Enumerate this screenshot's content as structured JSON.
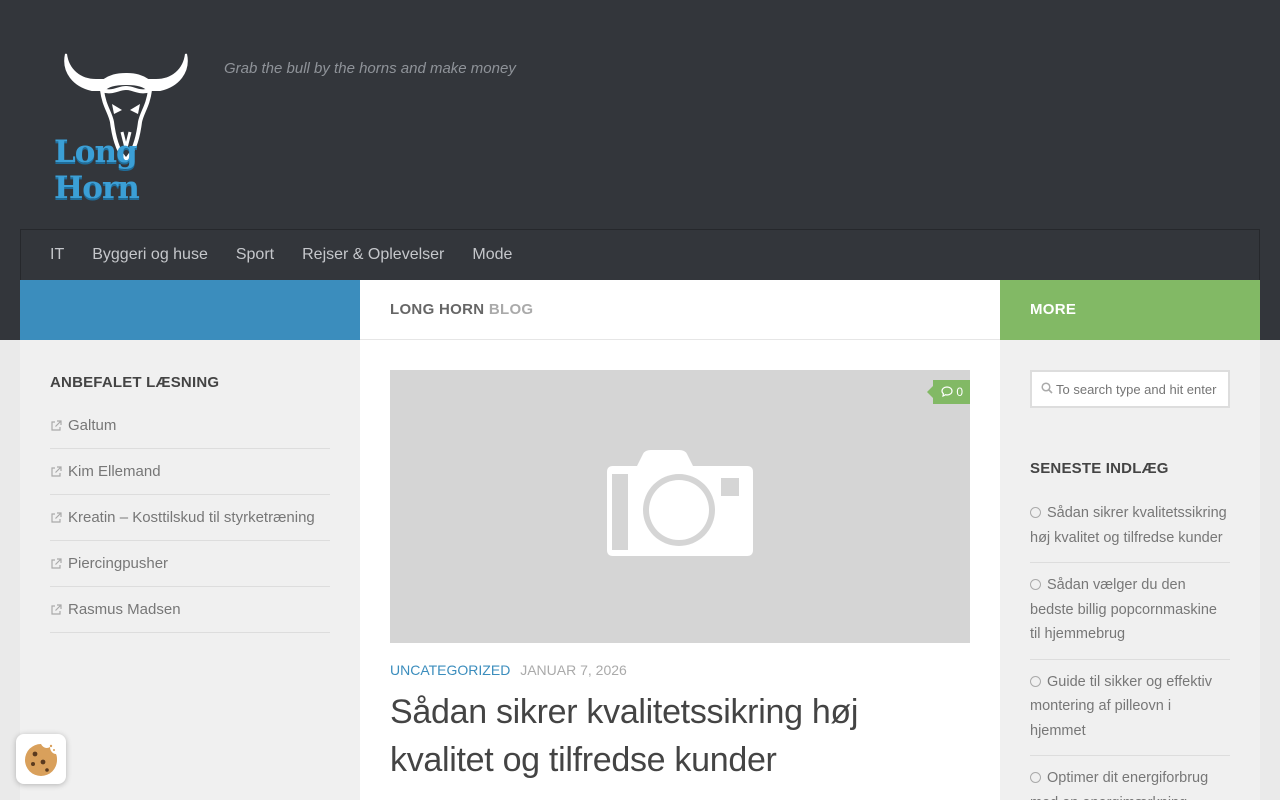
{
  "site": {
    "logo_text": "Long Horn",
    "tagline": "Grab the bull by the horns and make money"
  },
  "nav": {
    "items": [
      {
        "label": "IT"
      },
      {
        "label": "Byggeri og huse"
      },
      {
        "label": "Sport"
      },
      {
        "label": "Rejser & Oplevelser"
      },
      {
        "label": "Mode"
      }
    ]
  },
  "page_title": {
    "strong": "LONG HORN",
    "light": "BLOG"
  },
  "left_sidebar": {
    "title": "ANBEFALET LÆSNING",
    "links": [
      {
        "label": "Galtum"
      },
      {
        "label": "Kim Ellemand"
      },
      {
        "label": "Kreatin – Kosttilskud til styrketræning"
      },
      {
        "label": "Piercingpusher"
      },
      {
        "label": "Rasmus Madsen"
      }
    ]
  },
  "post": {
    "comment_count": "0",
    "category": "UNCATEGORIZED",
    "date": "JANUAR 7, 2026",
    "title": "Sådan sikrer kvalitetssikring høj kvalitet og tilfredse kunder"
  },
  "right_sidebar": {
    "header": "MORE",
    "search_placeholder": "To search type and hit enter",
    "recent_title": "SENESTE INDLÆG",
    "recent": [
      {
        "label": "Sådan sikrer kvalitetssikring høj kvalitet og tilfredse kunder"
      },
      {
        "label": "Sådan vælger du den bedste billig popcornmaskine til hjemmebrug"
      },
      {
        "label": "Guide til sikker og effektiv montering af pilleovn i hjemmet"
      },
      {
        "label": "Optimer dit energiforbrug med en energimærkning"
      }
    ]
  },
  "colors": {
    "header_bg": "#33363b",
    "blue": "#3b8dbd",
    "green": "#82b965"
  },
  "icons": {
    "external_link": "external-link-icon",
    "clock": "clock-icon",
    "search": "search-icon",
    "comment": "comment-icon",
    "camera": "camera-icon",
    "cookie": "cookie-icon"
  }
}
